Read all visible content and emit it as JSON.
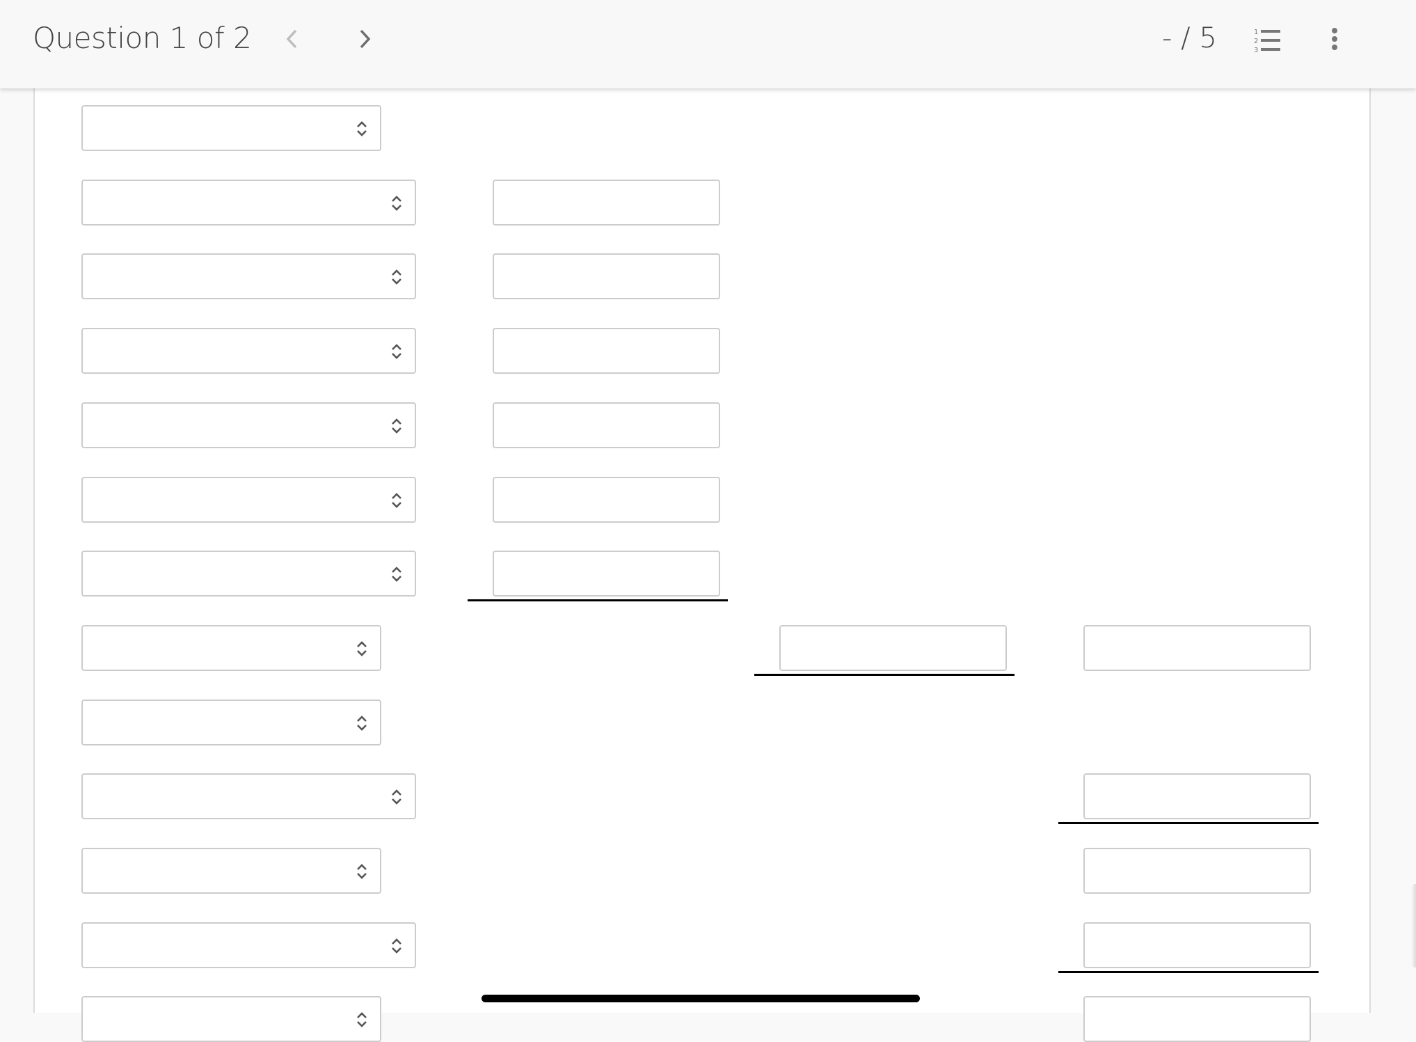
{
  "header": {
    "question_label": "Question 1 of 2",
    "prev_icon": "chevron-left-icon",
    "next_icon": "chevron-right-icon",
    "score": "- / 5",
    "list_icon": "numbered-list-icon",
    "more_icon": "more-vertical-icon"
  },
  "form": {
    "rows": [
      {
        "select": {
          "value": "",
          "width": "short"
        },
        "inputs": []
      },
      {
        "select": {
          "value": "",
          "width": "long"
        },
        "inputs": [
          {
            "col": 2,
            "value": ""
          }
        ]
      },
      {
        "select": {
          "value": "",
          "width": "long"
        },
        "inputs": [
          {
            "col": 2,
            "value": ""
          }
        ]
      },
      {
        "select": {
          "value": "",
          "width": "long"
        },
        "inputs": [
          {
            "col": 2,
            "value": ""
          }
        ]
      },
      {
        "select": {
          "value": "",
          "width": "long"
        },
        "inputs": [
          {
            "col": 2,
            "value": ""
          }
        ]
      },
      {
        "select": {
          "value": "",
          "width": "long"
        },
        "inputs": [
          {
            "col": 2,
            "value": ""
          }
        ]
      },
      {
        "select": {
          "value": "",
          "width": "long"
        },
        "inputs": [
          {
            "col": 2,
            "value": "",
            "underline": true
          }
        ]
      },
      {
        "select": {
          "value": "",
          "width": "short"
        },
        "inputs": [
          {
            "col": 3,
            "value": "",
            "underline": true
          },
          {
            "col": 4,
            "value": ""
          }
        ]
      },
      {
        "select": {
          "value": "",
          "width": "short"
        },
        "inputs": []
      },
      {
        "select": {
          "value": "",
          "width": "long"
        },
        "inputs": [
          {
            "col": 4,
            "value": "",
            "underline": true
          }
        ]
      },
      {
        "select": {
          "value": "",
          "width": "short"
        },
        "inputs": [
          {
            "col": 4,
            "value": ""
          }
        ]
      },
      {
        "select": {
          "value": "",
          "width": "long"
        },
        "inputs": [
          {
            "col": 4,
            "value": "",
            "underline": true
          }
        ]
      },
      {
        "select": {
          "value": "",
          "width": "short"
        },
        "inputs": [
          {
            "col": 4,
            "value": ""
          }
        ]
      }
    ]
  },
  "colors": {
    "field_border": "#cccccc",
    "header_bg": "#f8f8f8",
    "text": "#444444"
  }
}
